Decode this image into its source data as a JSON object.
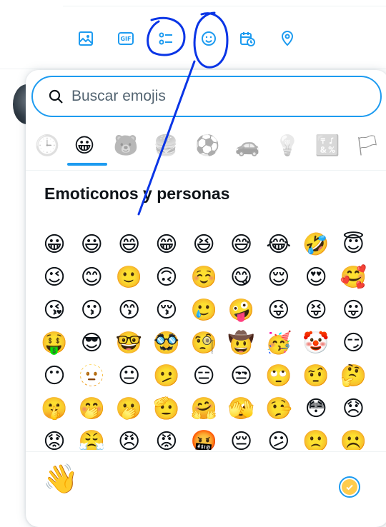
{
  "toolbar": {
    "icons": [
      "image-icon",
      "gif-icon",
      "poll-icon",
      "emoji-icon",
      "schedule-icon",
      "location-icon"
    ],
    "gif_label": "GIF",
    "accent": "#1d9bf0"
  },
  "emoji_picker": {
    "search_placeholder": "Buscar emojis",
    "categories": [
      {
        "name": "recientes",
        "glyph": "🕒"
      },
      {
        "name": "emoticonos-y-personas",
        "glyph": "😀",
        "active": true
      },
      {
        "name": "animales-y-naturaleza",
        "glyph": "🐻"
      },
      {
        "name": "comida-y-bebida",
        "glyph": "🍔"
      },
      {
        "name": "actividades",
        "glyph": "⚽"
      },
      {
        "name": "viajes-y-lugares",
        "glyph": "🚗"
      },
      {
        "name": "objetos",
        "glyph": "💡"
      },
      {
        "name": "simbolos",
        "glyph": "🔣"
      },
      {
        "name": "banderas",
        "glyph": "🏳"
      }
    ],
    "section_title": "Emoticonos y personas",
    "emojis": [
      [
        "😀",
        "😃",
        "😄",
        "😁",
        "😆",
        "😅",
        "😂",
        "🤣",
        "😇"
      ],
      [
        "😉",
        "😊",
        "🙂",
        "🙃",
        "☺️",
        "😋",
        "😌",
        "😍",
        "🥰"
      ],
      [
        "😘",
        "😗",
        "😙",
        "😚",
        "🥲",
        "🤪",
        "😜",
        "😝",
        "😛"
      ],
      [
        "🤑",
        "😎",
        "🤓",
        "🥸",
        "🧐",
        "🤠",
        "🥳",
        "🤡",
        "😏"
      ],
      [
        "😶",
        "🫥",
        "😐",
        "🫤",
        "😑",
        "😒",
        "🙄",
        "🤨",
        "🤔"
      ],
      [
        "🤫",
        "🤭",
        "🫢",
        "🫡",
        "🤗",
        "🫣",
        "🤥",
        "😳",
        "😞"
      ],
      [
        "😟",
        "😤",
        "😠",
        "😡",
        "🤬",
        "😔",
        "😕",
        "🙁",
        "☹️"
      ]
    ],
    "footer_emoji": "👋",
    "skin_tone_color": "#ffcc4d"
  }
}
